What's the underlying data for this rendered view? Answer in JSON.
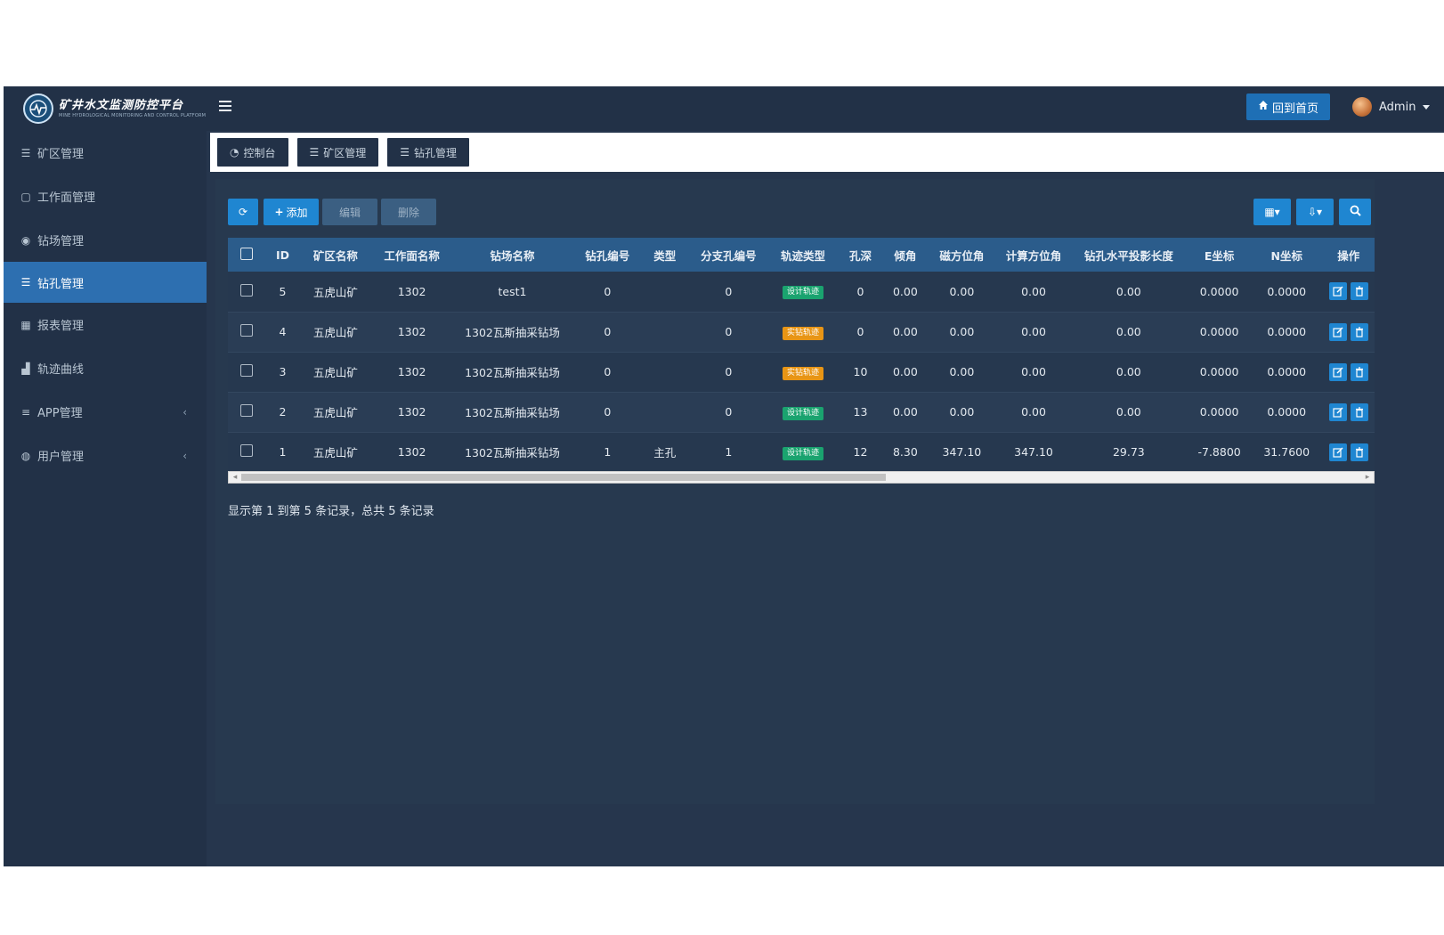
{
  "header": {
    "app_title": "矿井水文监测防控平台",
    "app_subtitle": "MINE HYDROLOGICAL MONITORING AND CONTROL PLATFORM",
    "home_button": "回到首页",
    "user_name": "Admin"
  },
  "sidebar": {
    "items": [
      {
        "label": "矿区管理",
        "icon": "list-icon"
      },
      {
        "label": "工作面管理",
        "icon": "square-icon"
      },
      {
        "label": "钻场管理",
        "icon": "circle-dot-icon"
      },
      {
        "label": "钻孔管理",
        "icon": "list-icon"
      },
      {
        "label": "报表管理",
        "icon": "table-icon"
      },
      {
        "label": "轨迹曲线",
        "icon": "bar-chart-icon"
      },
      {
        "label": "APP管理",
        "icon": "bars-icon"
      },
      {
        "label": "用户管理",
        "icon": "user-icon"
      }
    ]
  },
  "tabs": [
    {
      "label": "控制台"
    },
    {
      "label": "矿区管理"
    },
    {
      "label": "钻孔管理"
    }
  ],
  "toolbar": {
    "add_label": "添加",
    "edit_label": "编辑",
    "delete_label": "删除"
  },
  "table": {
    "columns": [
      "ID",
      "矿区名称",
      "工作面名称",
      "钻场名称",
      "钻孔编号",
      "类型",
      "分支孔编号",
      "轨迹类型",
      "孔深",
      "倾角",
      "磁方位角",
      "计算方位角",
      "钻孔水平投影长度",
      "E坐标",
      "N坐标",
      "操作"
    ],
    "rows": [
      {
        "id": "5",
        "mine": "五虎山矿",
        "face": "1302",
        "field": "test1",
        "hole_no": "0",
        "type": "",
        "branch_no": "0",
        "track": "设计轨迹",
        "track_color": "#1aa36f",
        "depth": "0",
        "dip": "0.00",
        "mag_az": "0.00",
        "calc_az": "0.00",
        "proj_len": "0.00",
        "e": "0.0000",
        "n": "0.0000"
      },
      {
        "id": "4",
        "mine": "五虎山矿",
        "face": "1302",
        "field": "1302瓦斯抽采钻场",
        "hole_no": "0",
        "type": "",
        "branch_no": "0",
        "track": "实钻轨迹",
        "track_color": "#e89515",
        "depth": "0",
        "dip": "0.00",
        "mag_az": "0.00",
        "calc_az": "0.00",
        "proj_len": "0.00",
        "e": "0.0000",
        "n": "0.0000"
      },
      {
        "id": "3",
        "mine": "五虎山矿",
        "face": "1302",
        "field": "1302瓦斯抽采钻场",
        "hole_no": "0",
        "type": "",
        "branch_no": "0",
        "track": "实钻轨迹",
        "track_color": "#e89515",
        "depth": "10",
        "dip": "0.00",
        "mag_az": "0.00",
        "calc_az": "0.00",
        "proj_len": "0.00",
        "e": "0.0000",
        "n": "0.0000"
      },
      {
        "id": "2",
        "mine": "五虎山矿",
        "face": "1302",
        "field": "1302瓦斯抽采钻场",
        "hole_no": "0",
        "type": "",
        "branch_no": "0",
        "track": "设计轨迹",
        "track_color": "#1aa36f",
        "depth": "13",
        "dip": "0.00",
        "mag_az": "0.00",
        "calc_az": "0.00",
        "proj_len": "0.00",
        "e": "0.0000",
        "n": "0.0000"
      },
      {
        "id": "1",
        "mine": "五虎山矿",
        "face": "1302",
        "field": "1302瓦斯抽采钻场",
        "hole_no": "1",
        "type": "主孔",
        "branch_no": "1",
        "track": "设计轨迹",
        "track_color": "#1aa36f",
        "depth": "12",
        "dip": "8.30",
        "mag_az": "347.10",
        "calc_az": "347.10",
        "proj_len": "29.73",
        "e": "-7.8800",
        "n": "31.7600"
      }
    ]
  },
  "pagination": {
    "info": "显示第 1 到第 5 条记录，总共 5 条记录"
  },
  "colors": {
    "accent": "#1f86d1",
    "sidebar_active": "#2d6fb0",
    "table_header": "#2b5c8b",
    "badge_design": "#1aa36f",
    "badge_actual": "#e89515"
  }
}
